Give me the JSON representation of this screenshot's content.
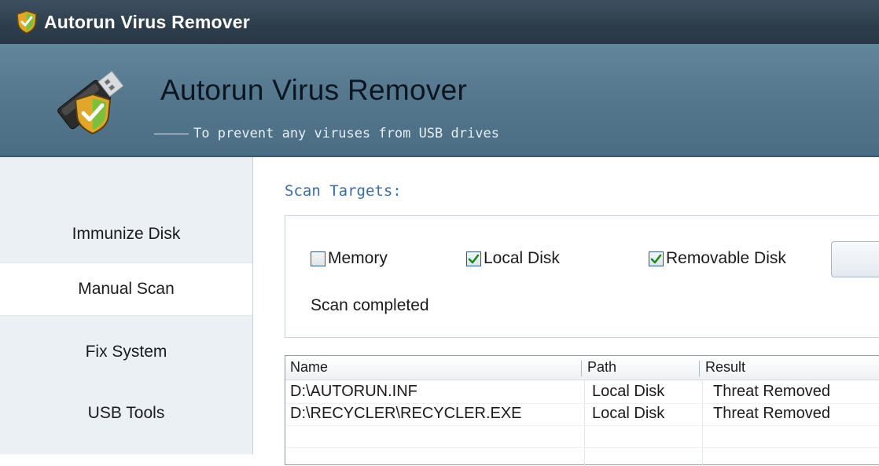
{
  "window": {
    "title": "Autorun Virus Remover",
    "icon": "shield-check-icon"
  },
  "header": {
    "app_name": "Autorun Virus Remover",
    "tagline": "To prevent any viruses from USB drives",
    "logo": "usb-shield-logo"
  },
  "sidebar": {
    "items": [
      {
        "label": "Immunize Disk",
        "active": false
      },
      {
        "label": "Manual Scan",
        "active": true
      },
      {
        "label": "Fix System",
        "active": false
      },
      {
        "label": "USB Tools",
        "active": false
      }
    ]
  },
  "scan": {
    "heading": "Scan Targets:",
    "options": [
      {
        "label": "Memory",
        "checked": false
      },
      {
        "label": "Local Disk",
        "checked": true
      },
      {
        "label": "Removable Disk",
        "checked": true
      }
    ],
    "status": "Scan completed"
  },
  "results": {
    "columns": [
      "Name",
      "Path",
      "Result"
    ],
    "rows": [
      {
        "name": "D:\\AUTORUN.INF",
        "path": "Local Disk",
        "result": "Threat Removed"
      },
      {
        "name": "D:\\RECYCLER\\RECYCLER.EXE",
        "path": "Local Disk",
        "result": "Threat Removed"
      }
    ]
  },
  "colors": {
    "titlebar": "#2d3d4c",
    "header": "#55788e",
    "heading_accent": "#3a6da6",
    "sidebar_bg": "#ebf0f5"
  }
}
